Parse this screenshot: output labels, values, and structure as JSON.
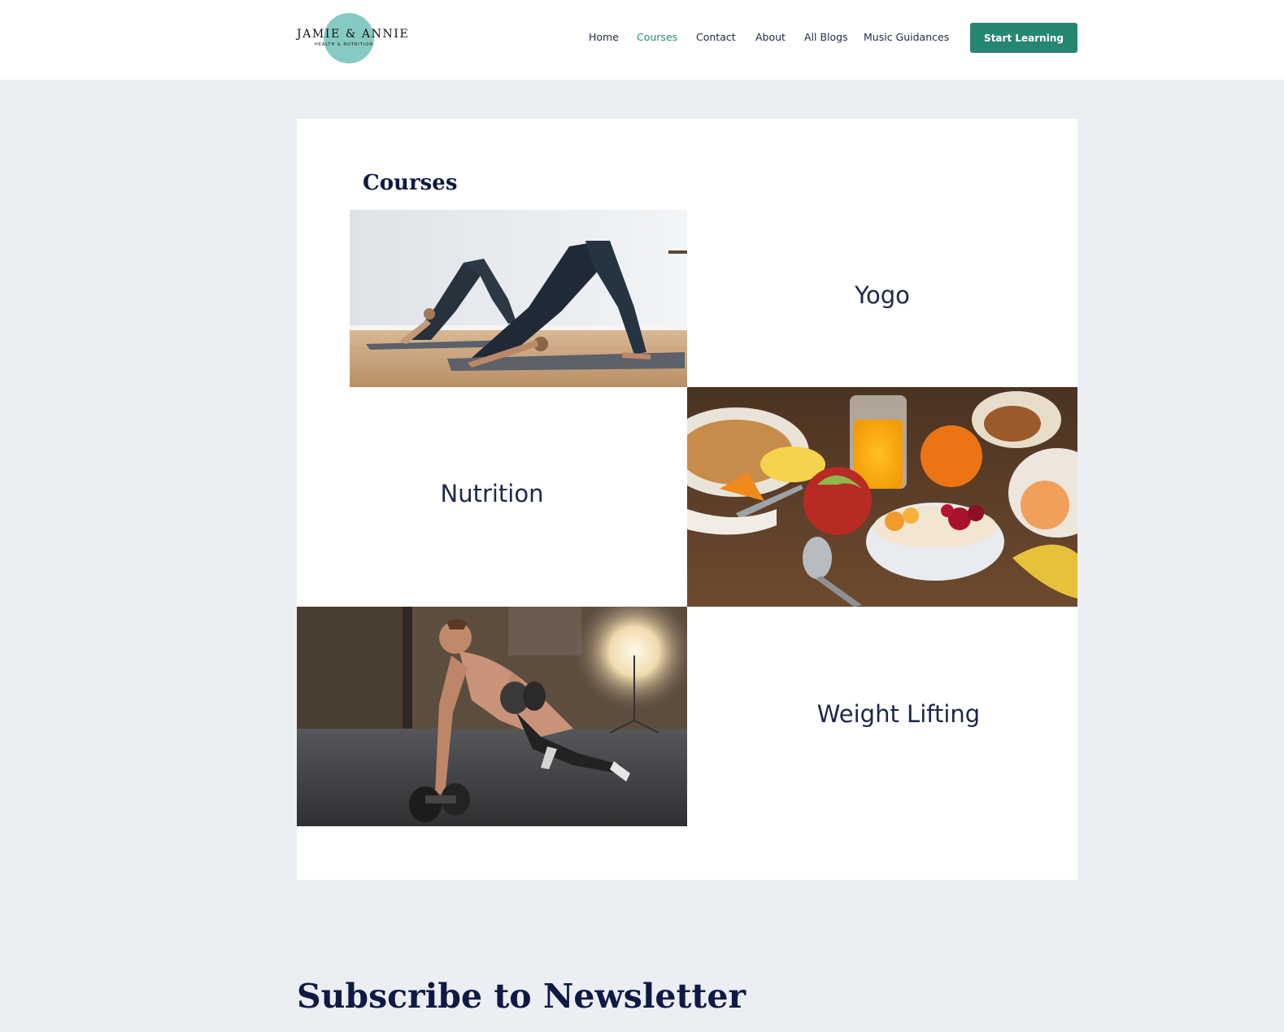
{
  "brand": {
    "name": "JAMIE & ANNIE",
    "tagline": "HEALTH & NUTRITION",
    "accent": "#268671",
    "logo_circle_color": "#86cbc3"
  },
  "nav": {
    "items": [
      {
        "label": "Home",
        "active": false
      },
      {
        "label": "Courses",
        "active": true
      },
      {
        "label": "Contact",
        "active": false
      },
      {
        "label": "About",
        "active": false
      },
      {
        "label": "All Blogs",
        "active": false
      },
      {
        "label": "Music Guidances",
        "active": false
      }
    ],
    "cta_label": "Start Learning"
  },
  "courses": {
    "title": "Courses",
    "items": [
      {
        "label": "Yogo",
        "image": "yoga-photo"
      },
      {
        "label": "Nutrition",
        "image": "breakfast-photo"
      },
      {
        "label": "Weight Lifting",
        "image": "dumbbell-pushup-photo"
      }
    ]
  },
  "newsletter": {
    "title": "Subscribe to Newsletter"
  }
}
